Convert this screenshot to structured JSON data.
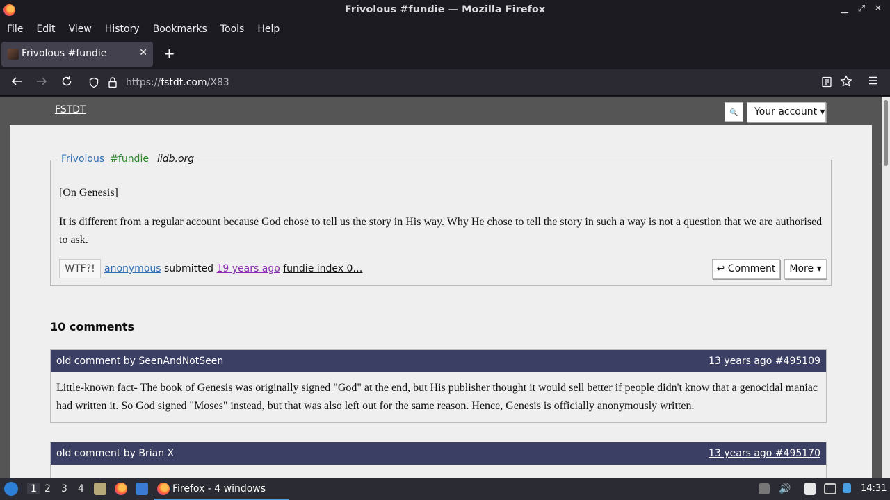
{
  "window": {
    "title": "Frivolous #fundie — Mozilla Firefox",
    "controls": [
      "▁",
      "⤢",
      "✕"
    ]
  },
  "menubar": [
    "File",
    "Edit",
    "View",
    "History",
    "Bookmarks",
    "Tools",
    "Help"
  ],
  "tab": {
    "label": "Frivolous #fundie",
    "close": "✕",
    "new": "+"
  },
  "nav": {
    "url_prefix": "https://",
    "url_host": "fstdt.com",
    "url_path": "/X83"
  },
  "site": {
    "logo": "FSTDT",
    "search_glyph": "🔍",
    "account": "Your account ▾"
  },
  "quote": {
    "category": "Frivolous",
    "tag": "#fundie",
    "source": "iidb.org",
    "paragraphs": [
      "[On Genesis]",
      "It is different from a regular account because God chose to tell us the story in His way. Why He chose to tell the story in such a way is not a question that we are authorised to ask."
    ],
    "wtf": "WTF?!",
    "user": "anonymous",
    "submitted": "submitted",
    "time": "19 years ago",
    "index": "fundie index 0…",
    "comment_btn": "↩ Comment",
    "more_btn": "More ▾"
  },
  "comments": {
    "heading": "10 comments",
    "items": [
      {
        "author": "old comment by SeenAndNotSeen",
        "date": "13 years ago #495109",
        "text": "Little-known fact- The book of Genesis was originally signed \"God\" at the end, but His publisher thought it would sell better if people didn't know that a genocidal maniac had written it. So God signed \"Moses\" instead, but that was also left out for the same reason. Hence, Genesis is officially anonymously written."
      },
      {
        "author": "old comment by Brian X",
        "date": "13 years ago #495170",
        "text": ""
      }
    ]
  },
  "taskbar": {
    "workspaces": [
      "1",
      "2",
      "3",
      "4"
    ],
    "task_label": "Firefox - 4 windows",
    "clock": "14:31"
  }
}
